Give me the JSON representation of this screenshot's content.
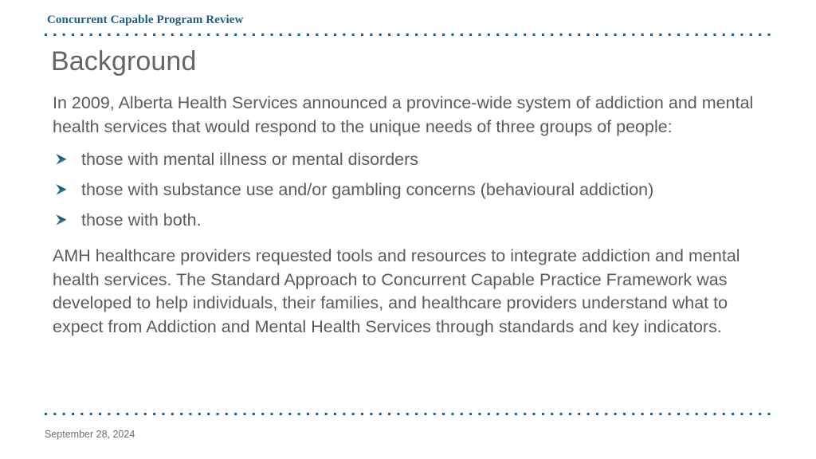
{
  "header": {
    "title": "Concurrent Capable Program Review",
    "rule_color": "#1f5c7f"
  },
  "slide": {
    "title": "Background",
    "intro_paragraph": "In 2009, Alberta Health Services announced a province-wide system of addiction and mental health services that would respond to the unique needs of three groups of people:",
    "bullets": [
      {
        "marker": "arrow-bullet-icon",
        "text": "those with mental illness or mental disorders"
      },
      {
        "marker": "arrow-bullet-icon",
        "text": "those with substance use and/or gambling concerns (behavioural addiction)"
      },
      {
        "marker": "arrow-bullet-icon",
        "text": "those with both."
      }
    ],
    "closing_paragraph": "AMH healthcare providers requested tools and resources to integrate addiction and mental health services. The Standard Approach to Concurrent Capable Practice Framework was developed to help individuals, their families, and healthcare providers understand what to expect from Addiction and Mental Health Services through standards and key indicators.",
    "title_color": "#636668",
    "body_color": "#595b5d",
    "bullet_color": "#2e6f94"
  },
  "footer": {
    "date": "September 28, 2024",
    "date_color": "#6c6e70"
  }
}
